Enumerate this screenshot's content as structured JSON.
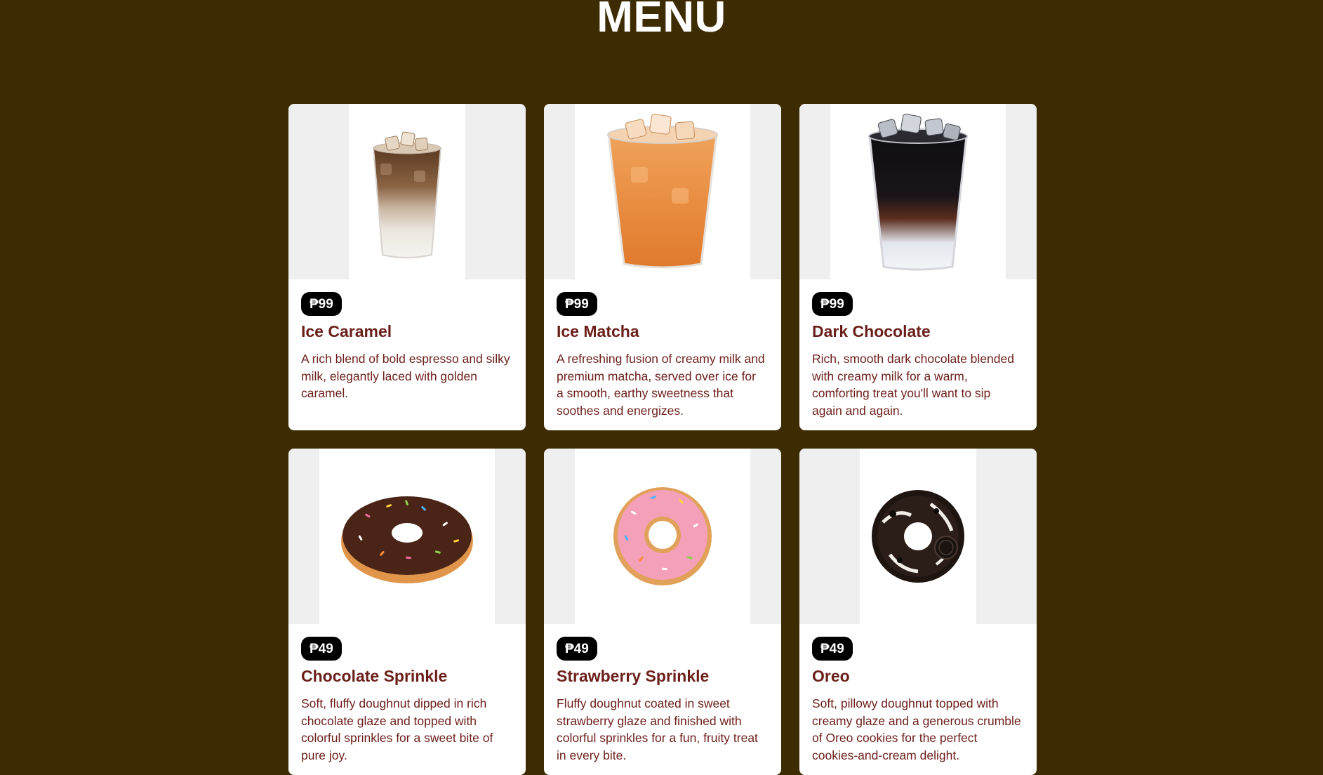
{
  "page": {
    "title": "MENU"
  },
  "colors": {
    "background": "#3d2c02",
    "card": "#ffffff",
    "image_side_panel": "#efefef",
    "price_badge": "#000000",
    "item_text": "#6b1f1a"
  },
  "items": [
    {
      "price": "₱99",
      "name": "Ice Caramel",
      "description": "A rich blend of bold espresso and silky milk, elegantly laced with golden caramel.",
      "image": "iced-caramel-latte-cup"
    },
    {
      "price": "₱99",
      "name": "Ice Matcha",
      "description": "A refreshing fusion of creamy milk and premium matcha, served over ice for a smooth, earthy sweetness that soothes and energizes.",
      "image": "iced-orange-milk-tea-cup"
    },
    {
      "price": "₱99",
      "name": "Dark Chocolate",
      "description": "Rich, smooth dark chocolate blended with creamy milk for a warm, comforting treat you'll want to sip again and again.",
      "image": "iced-dark-chocolate-cup"
    },
    {
      "price": "₱49",
      "name": "Chocolate Sprinkle",
      "description": "Soft, fluffy doughnut dipped in rich chocolate glaze and topped with colorful sprinkles for a sweet bite of pure joy.",
      "image": "chocolate-sprinkle-doughnut"
    },
    {
      "price": "₱49",
      "name": "Strawberry Sprinkle",
      "description": "Fluffy doughnut coated in sweet strawberry glaze and finished with colorful sprinkles for a fun, fruity treat in every bite.",
      "image": "strawberry-sprinkle-doughnut"
    },
    {
      "price": "₱49",
      "name": "Oreo",
      "description": "Soft, pillowy doughnut topped with creamy glaze and a generous crumble of Oreo cookies for the perfect cookies-and-cream delight.",
      "image": "oreo-doughnut"
    }
  ]
}
